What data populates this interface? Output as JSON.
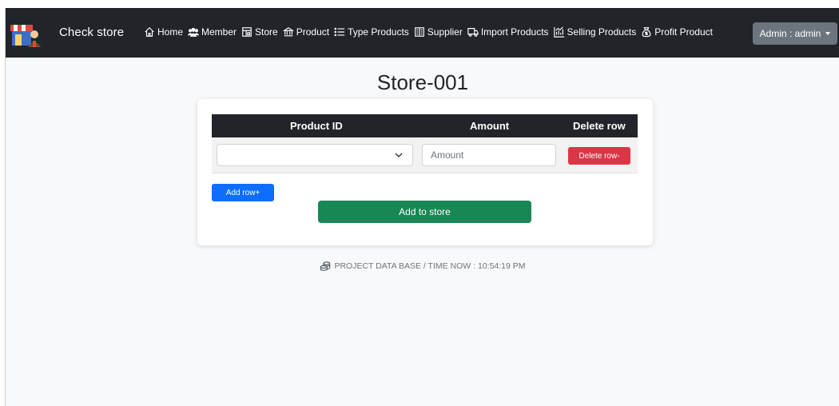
{
  "navbar": {
    "brand": "Check store",
    "items": [
      {
        "label": "Home",
        "icon": "house-icon"
      },
      {
        "label": "Member",
        "icon": "people-icon"
      },
      {
        "label": "Store",
        "icon": "shop-icon"
      },
      {
        "label": "Product",
        "icon": "bank-icon"
      },
      {
        "label": "Type Products",
        "icon": "list-icon"
      },
      {
        "label": "Supplier",
        "icon": "building-icon"
      },
      {
        "label": "Import Products",
        "icon": "truck-icon"
      },
      {
        "label": "Selling Products",
        "icon": "chart-icon"
      },
      {
        "label": "Profit Product",
        "icon": "money-bag-icon"
      }
    ],
    "user_menu": "Admin : admin"
  },
  "page": {
    "title": "Store-001"
  },
  "table": {
    "headers": [
      "Product ID",
      "Amount",
      "Delete row"
    ],
    "rows": [
      {
        "product_id": "",
        "amount_placeholder": "Amount",
        "delete_label": "Delete row-"
      }
    ]
  },
  "actions": {
    "add_row": "Add row+",
    "add_to_store": "Add to store"
  },
  "footer": {
    "text": "PROJECT DATA BASE / TIME NOW : 10:54:19 PM"
  },
  "colors": {
    "navbar": "#212529",
    "danger": "#dc3545",
    "primary": "#0d6efd",
    "success": "#198754",
    "secondary": "#6c757d"
  }
}
